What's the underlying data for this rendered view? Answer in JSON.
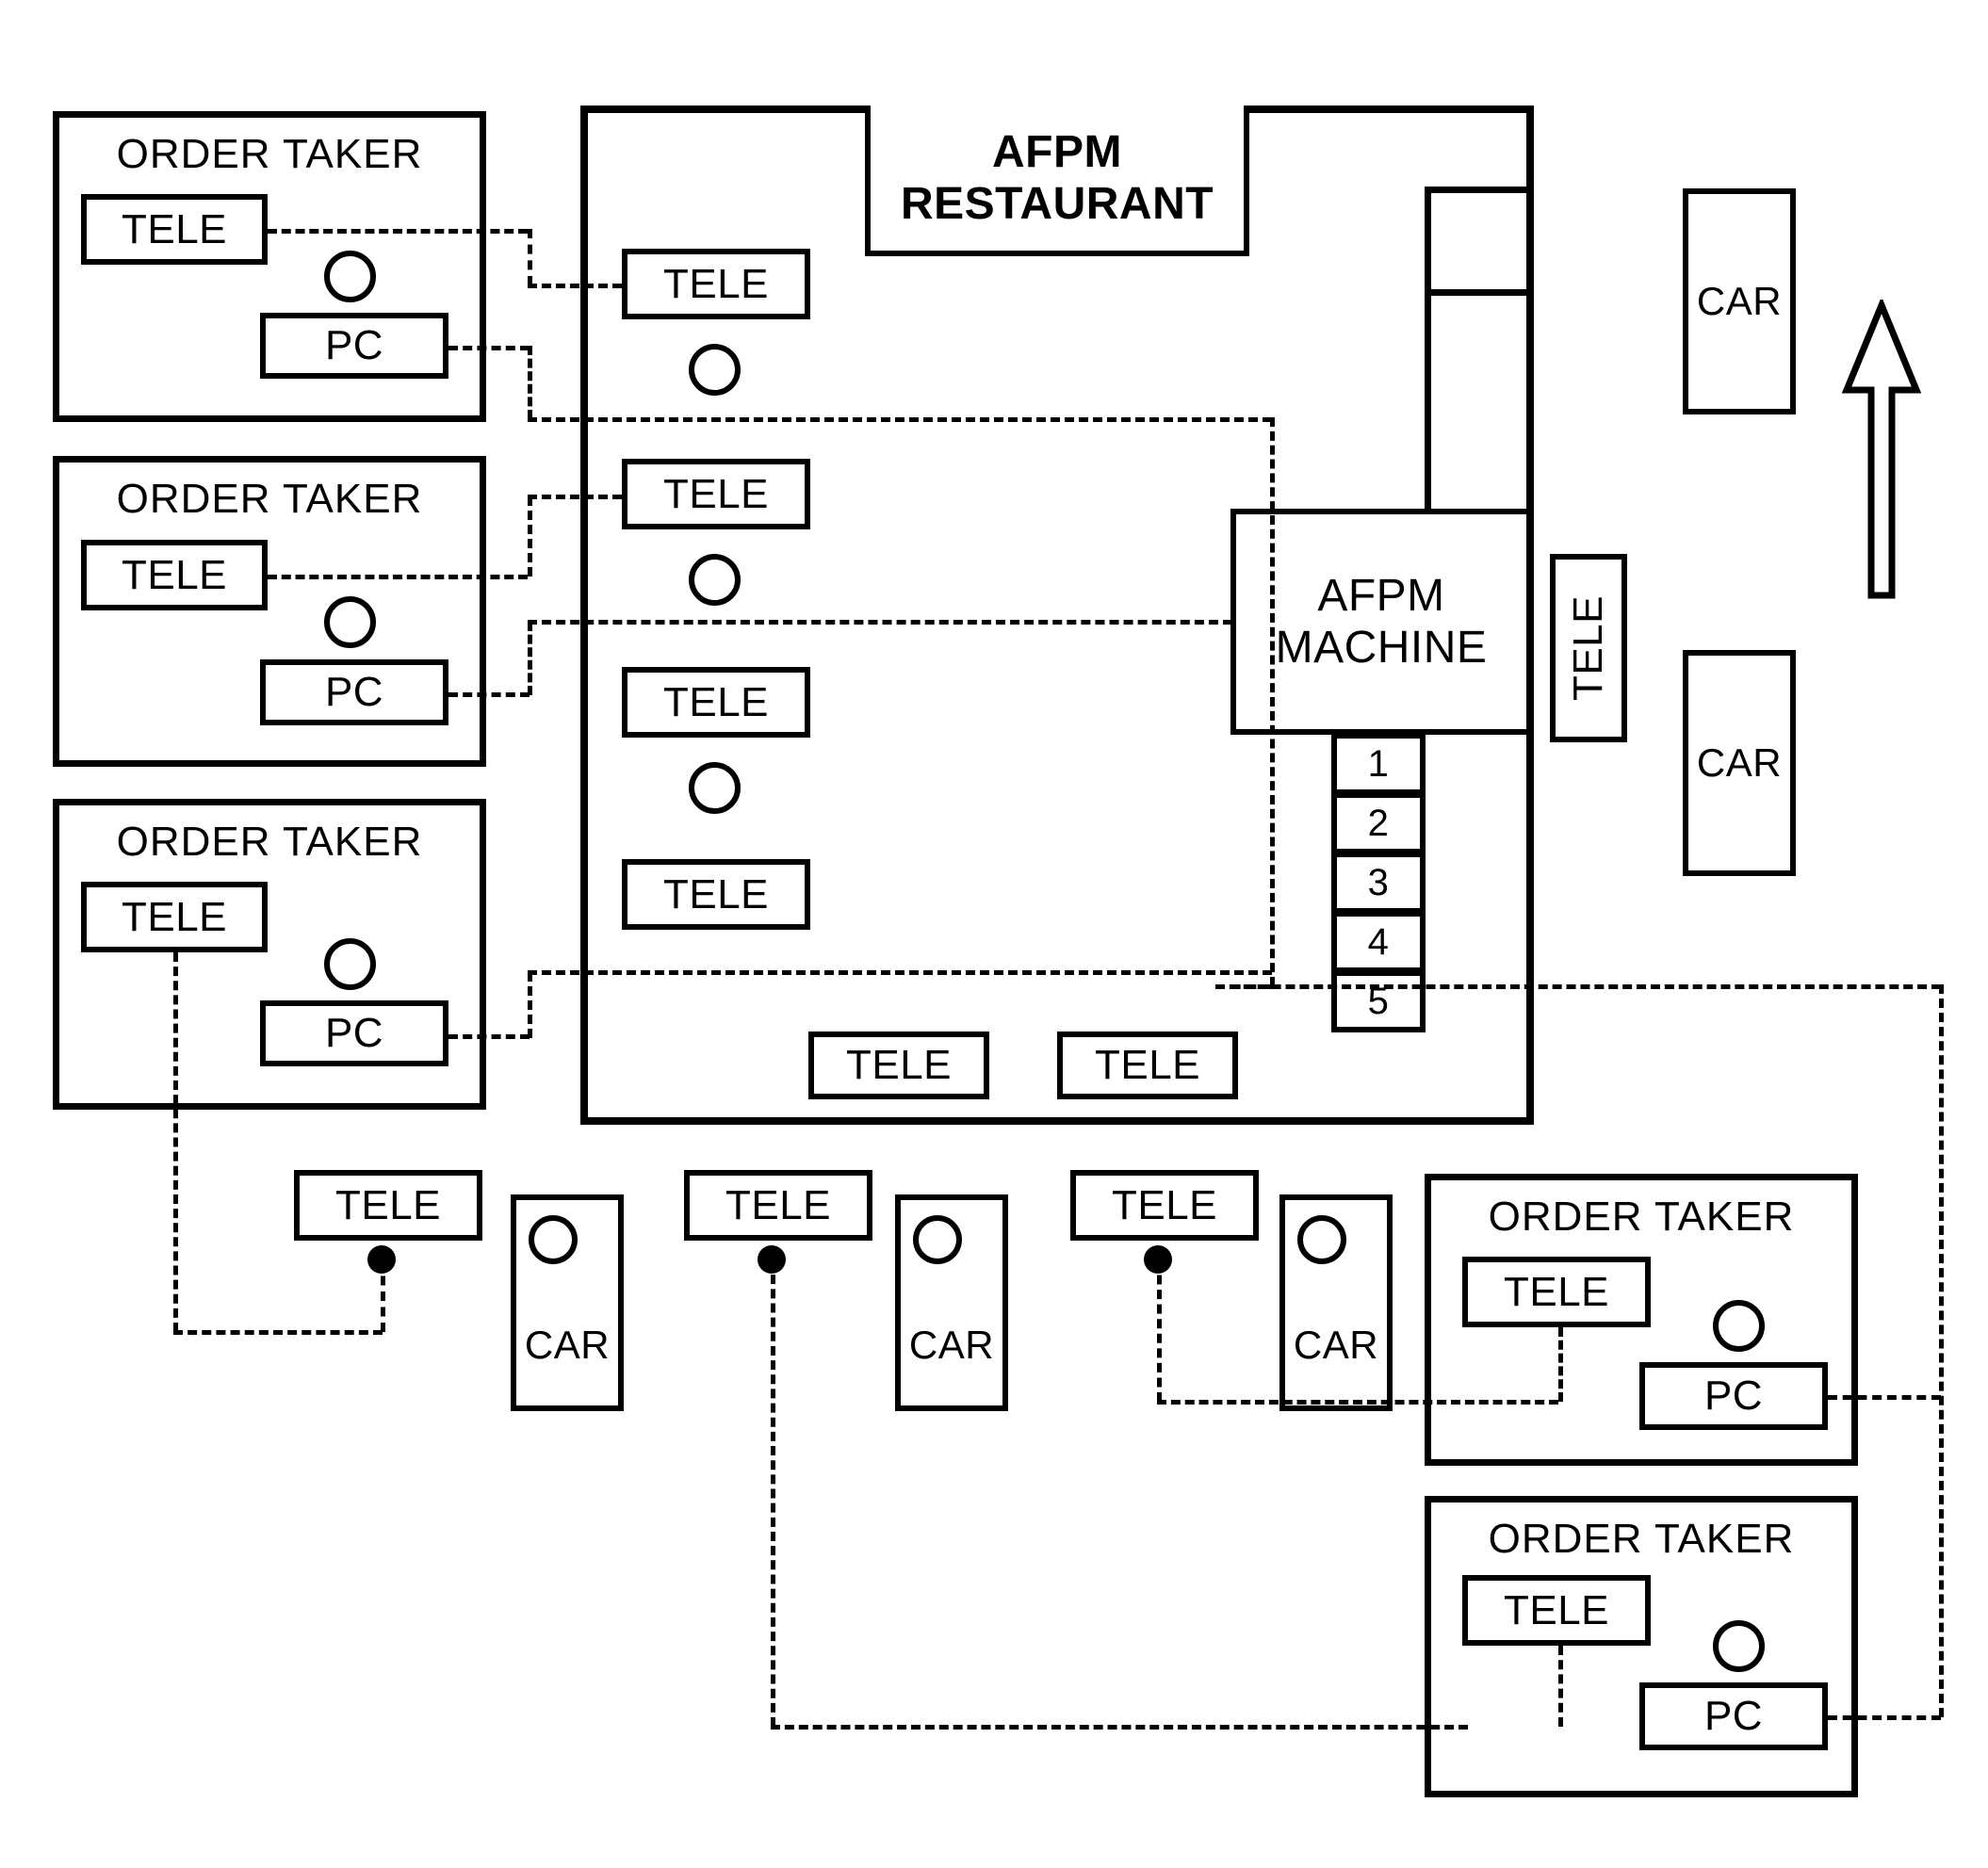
{
  "diagram": {
    "title": "AFPM RESTAURANT",
    "restaurant_label": "AFPM\nRESTAURANT",
    "restaurant_label_line1": "AFPM",
    "restaurant_label_line2": "RESTAURANT",
    "machine_label_line1": "AFPM",
    "machine_label_line2": "MACHINE",
    "labels": {
      "order_taker": "ORDER TAKER",
      "tele": "TELE",
      "pc": "PC",
      "car": "CAR"
    },
    "colors": {
      "line": "#000000",
      "fill": "#ffffff"
    }
  },
  "order_takers": [
    {
      "id": "order-taker-1",
      "title": "ORDER TAKER",
      "tele": "TELE",
      "pc": "PC"
    },
    {
      "id": "order-taker-2",
      "title": "ORDER TAKER",
      "tele": "TELE",
      "pc": "PC"
    },
    {
      "id": "order-taker-3",
      "title": "ORDER TAKER",
      "tele": "TELE",
      "pc": "PC"
    },
    {
      "id": "order-taker-4",
      "title": "ORDER TAKER",
      "tele": "TELE",
      "pc": "PC"
    },
    {
      "id": "order-taker-5",
      "title": "ORDER TAKER",
      "tele": "TELE",
      "pc": "PC"
    }
  ],
  "restaurant": {
    "name_line1": "AFPM",
    "name_line2": "RESTAURANT",
    "counter_teles": [
      "TELE",
      "TELE",
      "TELE",
      "TELE"
    ],
    "bottom_teles": [
      "TELE",
      "TELE"
    ],
    "machine": {
      "line1": "AFPM",
      "line2": "MACHINE"
    },
    "drive_thru_tele": "TELE",
    "queue_slots": [
      "1",
      "2",
      "3",
      "4",
      "5"
    ]
  },
  "curb_units": [
    {
      "tele": "TELE",
      "car": "CAR"
    },
    {
      "tele": "TELE",
      "car": "CAR"
    },
    {
      "tele": "TELE",
      "car": "CAR"
    }
  ],
  "lot_cars": [
    {
      "car": "CAR"
    },
    {
      "car": "CAR"
    }
  ],
  "traffic_arrow": {
    "direction": "up"
  }
}
